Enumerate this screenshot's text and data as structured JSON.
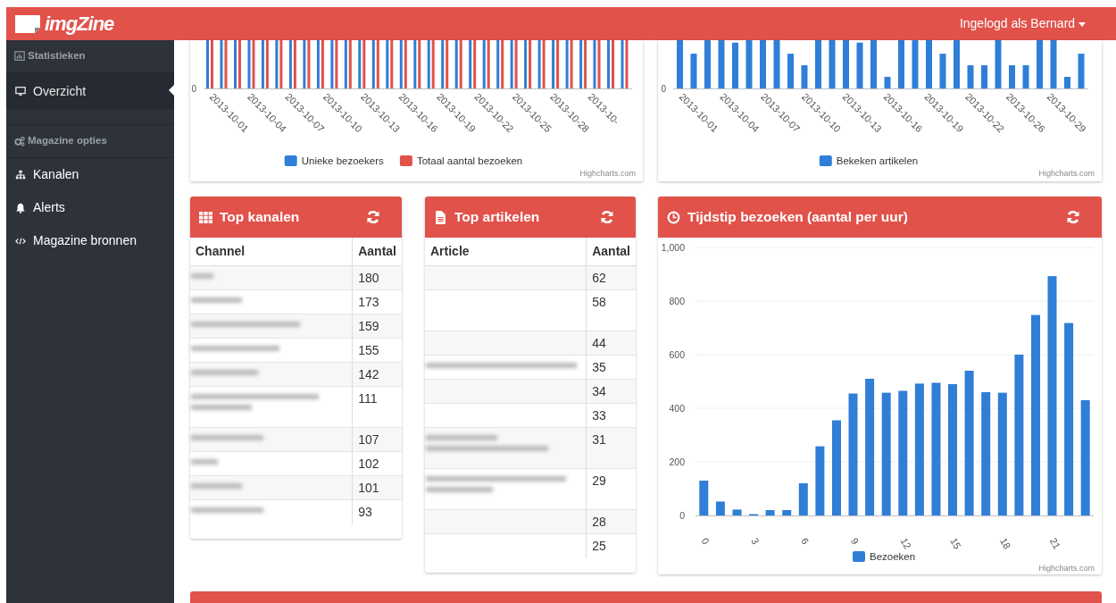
{
  "navbar": {
    "logo": "imgZine",
    "user_menu": "Ingelogd als Bernard"
  },
  "sidebar": {
    "sections": [
      {
        "title": "Statistieken",
        "items": [
          {
            "label": "Overzicht",
            "selected": true
          }
        ]
      },
      {
        "title": "Magazine opties",
        "items": [
          {
            "label": "Kanalen",
            "selected": false
          },
          {
            "label": "Alerts",
            "selected": false
          },
          {
            "label": "Magazine bronnen",
            "selected": false
          }
        ]
      }
    ]
  },
  "visitors_chart": {
    "y_zero": "0",
    "x_labels": [
      "2013-10-01",
      "2013-10-04",
      "2013-10-07",
      "2013-10-10",
      "2013-10-13",
      "2013-10-16",
      "2013-10-19",
      "2013-10-22",
      "2013-10-25",
      "2013-10-28",
      "2013-10-"
    ],
    "legend": [
      {
        "name": "Unieke bezoekers",
        "color": "#2f7ed8"
      },
      {
        "name": "Totaal aantal bezoeken",
        "color": "#e0524a"
      }
    ],
    "credit": "Highcharts.com"
  },
  "articles_chart": {
    "y_zero": "0",
    "x_labels": [
      "2013-10-01",
      "2013-10-04",
      "2013-10-07",
      "2013-10-10",
      "2013-10-13",
      "2013-10-16",
      "2013-10-19",
      "2013-10-22",
      "2013-10-26",
      "2013-10-29"
    ],
    "legend": [
      {
        "name": "Bekeken artikelen",
        "color": "#2f7ed8"
      }
    ],
    "credit": "Highcharts.com"
  },
  "top_channels": {
    "title": "Top kanalen",
    "columns": [
      "Channel",
      "Aantal"
    ],
    "rows": [
      {
        "count": "180",
        "tall": false,
        "redacted_lines": [
          {
            "level": 0.14
          }
        ]
      },
      {
        "count": "173",
        "tall": false,
        "redacted_lines": [
          {
            "level": 0.32
          }
        ]
      },
      {
        "count": "159",
        "tall": false,
        "redacted_lines": [
          {
            "level": 0.68
          }
        ]
      },
      {
        "count": "155",
        "tall": false,
        "redacted_lines": [
          {
            "level": 0.55
          }
        ]
      },
      {
        "count": "142",
        "tall": false,
        "redacted_lines": [
          {
            "level": 0.42
          }
        ]
      },
      {
        "count": "111",
        "tall": true,
        "redacted_lines": [
          {
            "level": 0.8
          },
          {
            "level": 0.38
          }
        ]
      },
      {
        "count": "107",
        "tall": false,
        "redacted_lines": [
          {
            "level": 0.45
          }
        ]
      },
      {
        "count": "102",
        "tall": false,
        "redacted_lines": [
          {
            "level": 0.17
          }
        ]
      },
      {
        "count": "101",
        "tall": false,
        "redacted_lines": [
          {
            "level": 0.32
          }
        ]
      },
      {
        "count": "93",
        "tall": false,
        "redacted_lines": [
          {
            "level": 0.45
          }
        ]
      }
    ]
  },
  "top_articles": {
    "title": "Top artikelen",
    "columns": [
      "Article",
      "Aantal"
    ],
    "rows": [
      {
        "count": "62",
        "tall": false
      },
      {
        "count": "58",
        "tall": true
      },
      {
        "count": "44",
        "tall": false
      },
      {
        "count": "35",
        "tall": false,
        "redacted_lines": [
          {
            "level": 0.95
          }
        ]
      },
      {
        "count": "34",
        "tall": false
      },
      {
        "count": "33",
        "tall": false
      },
      {
        "count": "31",
        "tall": true,
        "redacted_lines": [
          {
            "level": 0.45
          },
          {
            "level": 0.77
          }
        ]
      },
      {
        "count": "29",
        "tall": true,
        "redacted_lines": [
          {
            "level": 0.88
          },
          {
            "level": 0.42
          }
        ]
      },
      {
        "count": "28",
        "tall": false
      },
      {
        "count": "25",
        "tall": false
      }
    ]
  },
  "hourly_visits": {
    "title": "Tijdstip bezoeken (aantal per uur)",
    "credit": "Highcharts.com",
    "chart_data": {
      "type": "bar",
      "x": [
        0,
        1,
        2,
        3,
        4,
        5,
        6,
        7,
        8,
        9,
        10,
        11,
        12,
        13,
        14,
        15,
        16,
        17,
        18,
        19,
        20,
        21,
        22,
        23
      ],
      "series": [
        {
          "name": "Bezoeken",
          "color": "#2f7ed8",
          "values": [
            130,
            52,
            22,
            5,
            20,
            20,
            120,
            258,
            355,
            455,
            510,
            458,
            465,
            492,
            495,
            490,
            540,
            460,
            458,
            600,
            748,
            893,
            718,
            430
          ]
        }
      ],
      "ylim": [
        0,
        1000
      ],
      "yticks": [
        0,
        200,
        400,
        600,
        800,
        {
          "value": 1000,
          "label": "1,000"
        }
      ],
      "xlim": [
        -0.5,
        23.5
      ],
      "xticks": [
        0,
        3,
        6,
        9,
        12,
        15,
        18,
        21
      ],
      "grid": true
    }
  }
}
